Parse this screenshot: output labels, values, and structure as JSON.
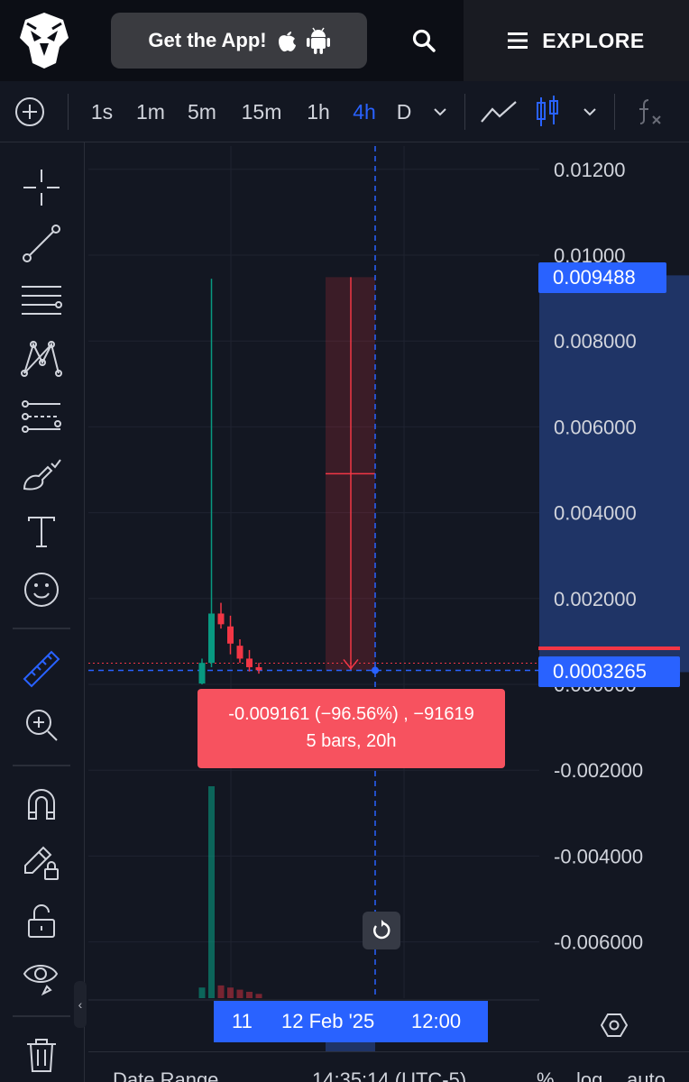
{
  "header": {
    "get_app_label": "Get the App!",
    "explore_label": "EXPLORE"
  },
  "toolbar": {
    "intervals": [
      "1s",
      "1m",
      "5m",
      "15m",
      "1h",
      "4h",
      "D"
    ],
    "active_interval": "4h"
  },
  "chart": {
    "price_axis_labels": [
      "0.01200",
      "0.01000",
      "0.008000",
      "0.006000",
      "0.004000",
      "0.002000",
      "0.000000",
      "-0.002000",
      "-0.004000",
      "-0.006000"
    ],
    "upper_price_badge": "0.009488",
    "current_price_badge": "0.0003265",
    "measure_tooltip_line1": "-0.009161 (−96.56%) , −91619",
    "measure_tooltip_line2": "5 bars, 20h",
    "time_axis": {
      "left": "11",
      "center": "12 Feb '25",
      "right": "12:00"
    },
    "colors": {
      "up": "#089981",
      "down": "#f23645",
      "accent": "#2962ff"
    }
  },
  "chart_data": {
    "type": "candlestick",
    "ylim": [
      -0.007,
      0.0125
    ],
    "candles": [
      {
        "o": 2e-05,
        "h": 0.0006,
        "l": 0.0,
        "c": 0.0005
      },
      {
        "o": 0.0005,
        "h": 0.00945,
        "l": 0.0004,
        "c": 0.00165
      },
      {
        "o": 0.00165,
        "h": 0.0019,
        "l": 0.0013,
        "c": 0.0014
      },
      {
        "o": 0.00135,
        "h": 0.0016,
        "l": 0.0007,
        "c": 0.00095
      },
      {
        "o": 0.0009,
        "h": 0.00105,
        "l": 0.0005,
        "c": 0.0006
      },
      {
        "o": 0.0006,
        "h": 0.0008,
        "l": 0.0003,
        "c": 0.0004
      },
      {
        "o": 0.0004,
        "h": 0.0005,
        "l": 0.00025,
        "c": 0.00033
      }
    ],
    "volumes": [
      0.05,
      1.0,
      0.06,
      0.05,
      0.04,
      0.03,
      0.02
    ],
    "volume_colors": [
      "up",
      "up",
      "down",
      "down",
      "down",
      "down",
      "down"
    ],
    "measurement": {
      "from_price": 0.009488,
      "to_price": 0.0003265,
      "change": "-0.009161",
      "change_pct": "-96.56%",
      "bars": 5,
      "duration": "20h"
    }
  },
  "bottom_bar": {
    "date_range": "Date Range",
    "time": "14:35:14 (UTC-5)",
    "percent": "%",
    "log": "log",
    "auto": "auto"
  }
}
